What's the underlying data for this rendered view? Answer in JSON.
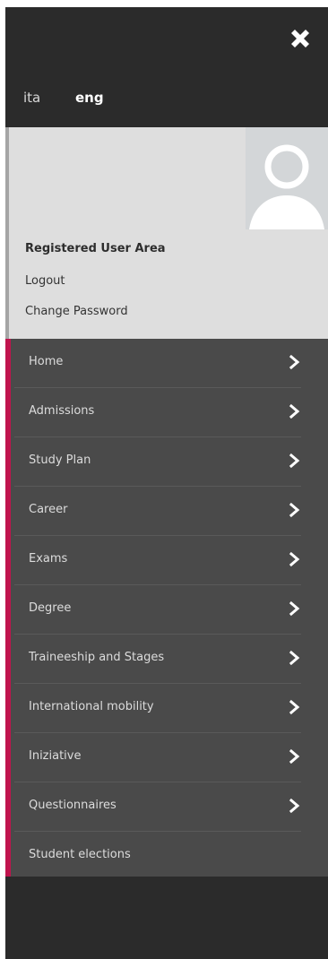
{
  "header": {
    "close_icon": "close-icon"
  },
  "languages": {
    "ita": "ita",
    "eng": "eng",
    "active": "eng"
  },
  "user_area": {
    "title": "Registered User Area",
    "logout": "Logout",
    "change_password": "Change Password",
    "avatar_icon": "avatar-icon"
  },
  "menu": {
    "items": [
      {
        "label": "Home",
        "has_chevron": true
      },
      {
        "label": "Admissions",
        "has_chevron": true
      },
      {
        "label": "Study Plan",
        "has_chevron": true
      },
      {
        "label": "Career",
        "has_chevron": true
      },
      {
        "label": "Exams",
        "has_chevron": true
      },
      {
        "label": "Degree",
        "has_chevron": true
      },
      {
        "label": "Traineeship and Stages",
        "has_chevron": true
      },
      {
        "label": "International mobility",
        "has_chevron": true
      },
      {
        "label": "Iniziative",
        "has_chevron": true
      },
      {
        "label": "Questionnaires",
        "has_chevron": true
      },
      {
        "label": "Student elections",
        "has_chevron": false
      }
    ]
  },
  "colors": {
    "panel_dark": "#2b2b2b",
    "menu_bg": "#4a4a4a",
    "user_area_bg": "#dedede",
    "accent": "#c0144d"
  }
}
